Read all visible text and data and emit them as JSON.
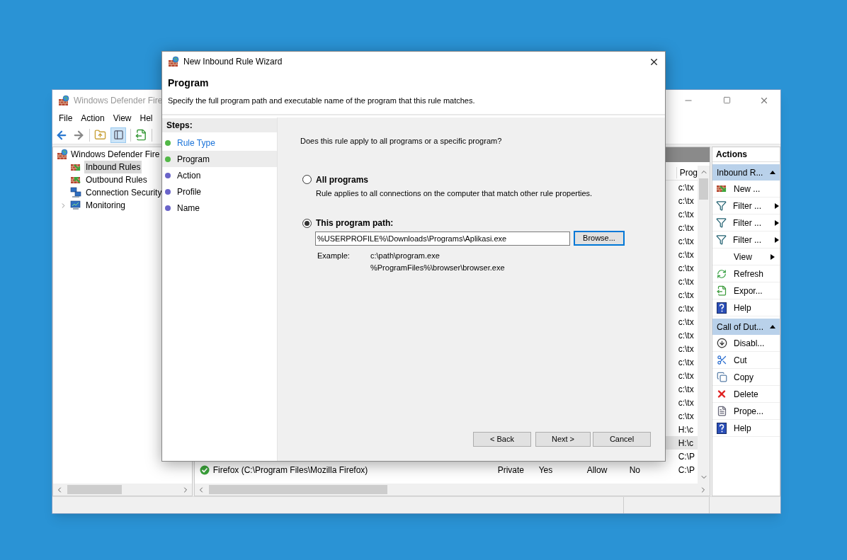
{
  "main_window": {
    "title": "Windows Defender Fire",
    "menu": [
      "File",
      "Action",
      "View",
      "Hel"
    ],
    "tree": [
      {
        "label": "Windows Defender Fire",
        "children": [
          {
            "label": "Inbound Rules",
            "selected": true
          },
          {
            "label": "Outbound Rules",
            "selected": false
          },
          {
            "label": "Connection Security",
            "selected": false
          },
          {
            "label": "Monitoring",
            "selected": false,
            "expanded": false
          }
        ]
      }
    ],
    "rules": {
      "columns": [
        "Prog"
      ],
      "rows": [
        {
          "program": "c:\\tx",
          "selected": false
        },
        {
          "program": "c:\\tx",
          "selected": false
        },
        {
          "program": "c:\\tx",
          "selected": false
        },
        {
          "program": "c:\\tx",
          "selected": false
        },
        {
          "program": "c:\\tx",
          "selected": false
        },
        {
          "program": "c:\\tx",
          "selected": false
        },
        {
          "program": "c:\\tx",
          "selected": false
        },
        {
          "program": "c:\\tx",
          "selected": false
        },
        {
          "program": "c:\\tx",
          "selected": false
        },
        {
          "program": "c:\\tx",
          "selected": false
        },
        {
          "program": "c:\\tx",
          "selected": false
        },
        {
          "program": "c:\\tx",
          "selected": false
        },
        {
          "program": "c:\\tx",
          "selected": false
        },
        {
          "program": "c:\\tx",
          "selected": false
        },
        {
          "program": "c:\\tx",
          "selected": false
        },
        {
          "program": "c:\\tx",
          "selected": false
        },
        {
          "program": "c:\\tx",
          "selected": false
        },
        {
          "program": "c:\\tx",
          "selected": false
        },
        {
          "program": "H:\\c",
          "selected": false
        },
        {
          "program": "H:\\c",
          "selected": true
        },
        {
          "program": "C:\\P",
          "selected": false
        },
        {
          "name": "Firefox (C:\\Program Files\\Mozilla Firefox)",
          "enabled_icon": true,
          "profile": "Private",
          "enabled": "Yes",
          "action": "Allow",
          "override": "No",
          "program": "C:\\P",
          "selected": false
        }
      ]
    },
    "actions": {
      "title": "Actions",
      "sections": [
        {
          "title": "Inbound R...",
          "expanded": true,
          "items": [
            {
              "label": "New ...",
              "submenu": false
            },
            {
              "label": "Filter ...",
              "submenu": true
            },
            {
              "label": "Filter ...",
              "submenu": true
            },
            {
              "label": "Filter ...",
              "submenu": true
            },
            {
              "label": "View",
              "submenu": true
            },
            {
              "label": "Refresh",
              "submenu": false
            },
            {
              "label": "Expor...",
              "submenu": false
            },
            {
              "label": "Help",
              "submenu": false
            }
          ]
        },
        {
          "title": "Call of Dut...",
          "expanded": true,
          "items": [
            {
              "label": "Disabl...",
              "submenu": false
            },
            {
              "label": "Cut",
              "submenu": false
            },
            {
              "label": "Copy",
              "submenu": false
            },
            {
              "label": "Delete",
              "submenu": false
            },
            {
              "label": "Prope...",
              "submenu": false
            },
            {
              "label": "Help",
              "submenu": false
            }
          ]
        }
      ]
    }
  },
  "wizard": {
    "title": "New Inbound Rule Wizard",
    "heading": "Program",
    "description": "Specify the full program path and executable name of the program that this rule matches.",
    "steps_title": "Steps:",
    "steps": [
      {
        "label": "Rule Type",
        "complete": true,
        "selected": false,
        "link": true
      },
      {
        "label": "Program",
        "complete": true,
        "selected": true,
        "link": false
      },
      {
        "label": "Action",
        "complete": false,
        "selected": false,
        "link": false
      },
      {
        "label": "Profile",
        "complete": false,
        "selected": false,
        "link": false
      },
      {
        "label": "Name",
        "complete": false,
        "selected": false,
        "link": false
      }
    ],
    "question": "Does this rule apply to all programs or a specific program?",
    "options": [
      {
        "label": "All programs",
        "selected": false,
        "description": "Rule applies to all connections on the computer that match other rule properties."
      },
      {
        "label": "This program path:",
        "selected": true
      }
    ],
    "path": {
      "value": "%USERPROFILE%\\Downloads\\Programs\\Aplikasi.exe"
    },
    "browse": {
      "label": "Browse...",
      "focused": true
    },
    "example_label": "Example:",
    "examples": [
      "c:\\path\\program.exe",
      "%ProgramFiles%\\browser\\browser.exe"
    ],
    "buttons": [
      "< Back",
      "Next >",
      "Cancel"
    ]
  }
}
